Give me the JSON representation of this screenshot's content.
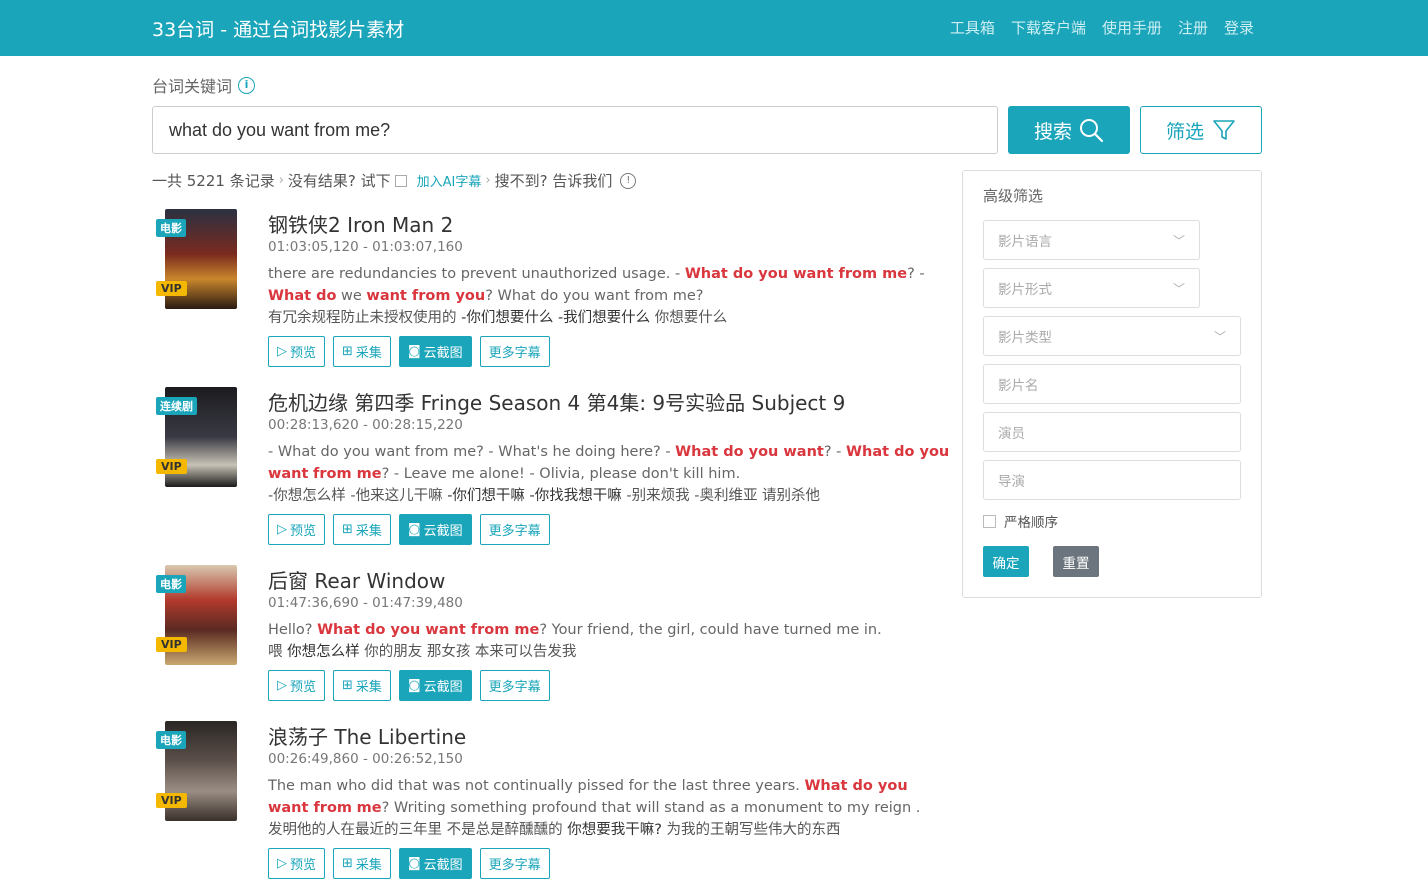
{
  "header": {
    "brand": "33台词 - 通过台词找影片素材",
    "nav": [
      "工具箱",
      "下载客户端",
      "使用手册",
      "注册",
      "登录"
    ]
  },
  "search": {
    "label": "台词关键词",
    "value": "what do you want from me?",
    "search_label": "搜索",
    "filter_label": "筛选"
  },
  "summary": {
    "count_text": "一共 5221 条记录",
    "no_result": "没有结果? 试下",
    "ai_link": "加入AI字幕",
    "not_found": "搜不到? 告诉我们"
  },
  "results": [
    {
      "type": "电影",
      "vip": "VIP",
      "title": "钢铁侠2 Iron Man 2",
      "time": "01:03:05,120 - 01:03:07,160",
      "en_parts": [
        "there are redundancies to prevent unauthorized usage.  - ",
        "What do you want from me",
        "? - ",
        "What do",
        " we ",
        "want from you",
        "? What do you want from me?"
      ],
      "cn_plain_1": "有冗余规程防止未授权使用的 ",
      "cn_hl": " -你们想要什么 -我们想要什么 ",
      "cn_plain_2": "你想要什么"
    },
    {
      "type": "连续剧",
      "vip": "VIP",
      "title": "危机边缘 第四季 Fringe Season 4 第4集: 9号实验品 Subject 9",
      "time": "00:28:13,620 - 00:28:15,220",
      "en_parts": [
        "- What do you want from me? - What's he doing here?  - ",
        "What do you want",
        "? - ",
        "What do you want",
        " ",
        "from me",
        "? - Leave me alone! - Olivia, please don't kill him."
      ],
      "cn_plain_1": "-你想怎么样 -他来这儿干嘛 ",
      "cn_hl": " -你们想干嘛 -你找我想干嘛 ",
      "cn_plain_2": "-别来烦我 -奥利维亚 请别杀他"
    },
    {
      "type": "电影",
      "vip": "VIP",
      "title": "后窗 Rear Window",
      "time": "01:47:36,690 - 01:47:39,480",
      "en_parts": [
        "Hello?  ",
        "What do you want from me",
        "? Your friend, the girl, could have turned me in."
      ],
      "cn_plain_1": "喂  ",
      "cn_hl": "你想怎么样 ",
      "cn_plain_2": "你的朋友 那女孩 本来可以告发我"
    },
    {
      "type": "电影",
      "vip": "VIP",
      "title": "浪荡子 The Libertine",
      "time": "00:26:49,860 - 00:26:52,150",
      "en_parts": [
        "The man who did that was not continually pissed for the last three years.  ",
        "What do you want from",
        " ",
        "me",
        "? Writing something profound that will stand as a monument to my reign ."
      ],
      "cn_plain_1": "发明他的人在最近的三年里 不是总是醉醺醺的  ",
      "cn_hl": "你想要我干嘛? ",
      "cn_plain_2": "为我的王朝写些伟大的东西"
    }
  ],
  "actions": {
    "preview": "预览",
    "collect": "采集",
    "cloud_shot": "云截图",
    "more_subs": "更多字幕"
  },
  "filter_panel": {
    "title": "高级筛选",
    "language_placeholder": "影片语言",
    "format_placeholder": "影片形式",
    "genre_placeholder": "影片类型",
    "name_placeholder": "影片名",
    "actor_placeholder": "演员",
    "director_placeholder": "导演",
    "strict_label": "严格顺序",
    "ok_label": "确定",
    "reset_label": "重置"
  },
  "colors": {
    "accent": "#1aa5ba",
    "highlight": "#d9363e",
    "vip": "#f5b800"
  }
}
